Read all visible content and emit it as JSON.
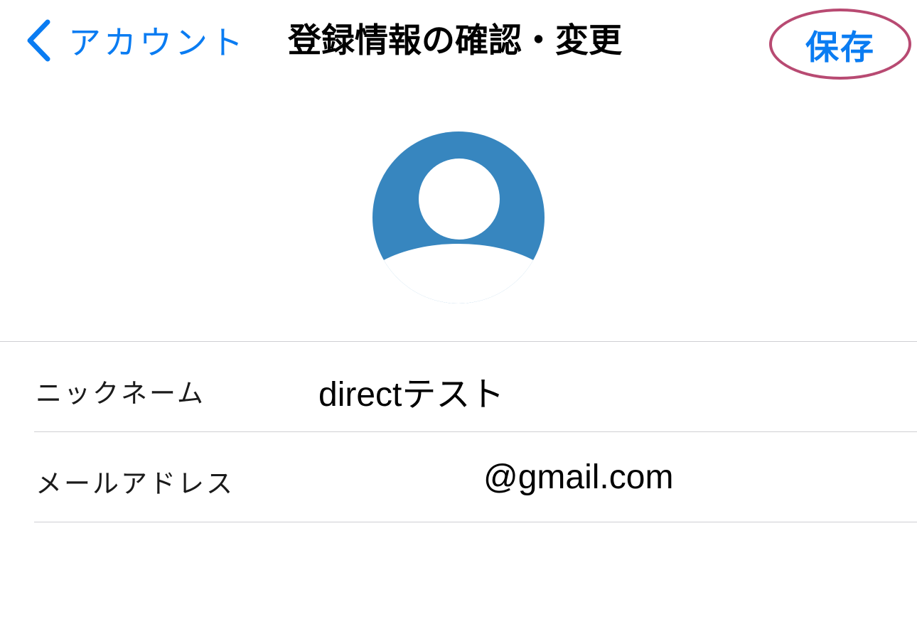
{
  "nav": {
    "back_label": "アカウント",
    "title": "登録情報の確認・変更",
    "save_label": "保存"
  },
  "colors": {
    "accent": "#0a7cf2",
    "highlight_ring": "#b84a72",
    "avatar_bg": "#3786bf",
    "divider": "#cfcfd3"
  },
  "icons": {
    "back": "chevron-left-icon",
    "avatar": "person-icon"
  },
  "profile": {
    "fields": [
      {
        "label": "ニックネーム",
        "value": "directテスト"
      },
      {
        "label": "メールアドレス",
        "value": "@gmail.com"
      }
    ]
  }
}
